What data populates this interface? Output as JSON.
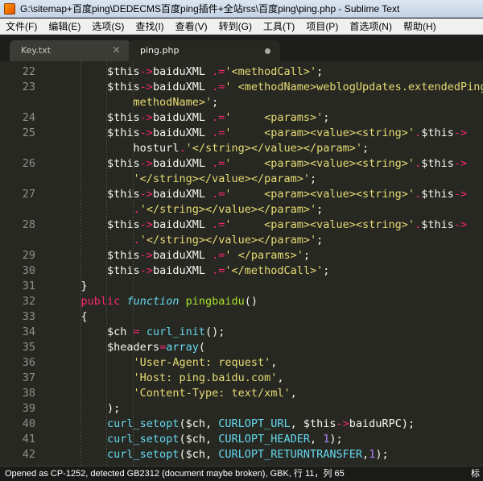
{
  "window": {
    "title": "G:\\sitemap+百度ping\\DEDECMS百度ping插件+全站rss\\百度ping\\ping.php - Sublime Text"
  },
  "menu": [
    {
      "name": "menu-file",
      "label": "文件(F)"
    },
    {
      "name": "menu-edit",
      "label": "编辑(E)"
    },
    {
      "name": "menu-selection",
      "label": "选项(S)"
    },
    {
      "name": "menu-find",
      "label": "查找(I)"
    },
    {
      "name": "menu-view",
      "label": "查看(V)"
    },
    {
      "name": "menu-goto",
      "label": "转到(G)"
    },
    {
      "name": "menu-tools",
      "label": "工具(T)"
    },
    {
      "name": "menu-project",
      "label": "项目(P)"
    },
    {
      "name": "menu-preferences",
      "label": "首选项(N)"
    },
    {
      "name": "menu-help",
      "label": "帮助(H)"
    }
  ],
  "tabs": [
    {
      "label": "Key.txt",
      "active": false
    },
    {
      "label": "ping.php",
      "active": true
    }
  ],
  "editor": {
    "lines": [
      {
        "n": "22",
        "tokens": [
          [
            "        ",
            ""
          ],
          [
            "$this",
            "t-var"
          ],
          [
            "->",
            "t-op"
          ],
          [
            "baiduXML ",
            "t-var"
          ],
          [
            ".=",
            "t-op"
          ],
          [
            "'<methodCall>'",
            "t-str"
          ],
          [
            ";",
            "t-var"
          ]
        ]
      },
      {
        "n": "23",
        "tokens": [
          [
            "        ",
            ""
          ],
          [
            "$this",
            "t-var"
          ],
          [
            "->",
            "t-op"
          ],
          [
            "baiduXML ",
            "t-var"
          ],
          [
            ".=",
            "t-op"
          ],
          [
            "' <methodName>weblogUpdates.extendedPing</",
            "t-str"
          ]
        ]
      },
      {
        "n": "",
        "tokens": [
          [
            "            ",
            ""
          ],
          [
            "methodName>'",
            "t-str"
          ],
          [
            ";",
            "t-var"
          ]
        ]
      },
      {
        "n": "24",
        "tokens": [
          [
            "        ",
            ""
          ],
          [
            "$this",
            "t-var"
          ],
          [
            "->",
            "t-op"
          ],
          [
            "baiduXML ",
            "t-var"
          ],
          [
            ".=",
            "t-op"
          ],
          [
            "'     <params>'",
            "t-str"
          ],
          [
            ";",
            "t-var"
          ]
        ]
      },
      {
        "n": "25",
        "tokens": [
          [
            "        ",
            ""
          ],
          [
            "$this",
            "t-var"
          ],
          [
            "->",
            "t-op"
          ],
          [
            "baiduXML ",
            "t-var"
          ],
          [
            ".=",
            "t-op"
          ],
          [
            "'     <param><value><string>'",
            "t-str"
          ],
          [
            ".",
            "t-op"
          ],
          [
            "$this",
            "t-var"
          ],
          [
            "->",
            "t-op"
          ]
        ]
      },
      {
        "n": "",
        "tokens": [
          [
            "            ",
            ""
          ],
          [
            "hosturl",
            "t-var"
          ],
          [
            ".",
            "t-op"
          ],
          [
            "'</string></value></param>'",
            "t-str"
          ],
          [
            ";",
            "t-var"
          ]
        ]
      },
      {
        "n": "26",
        "tokens": [
          [
            "        ",
            ""
          ],
          [
            "$this",
            "t-var"
          ],
          [
            "->",
            "t-op"
          ],
          [
            "baiduXML ",
            "t-var"
          ],
          [
            ".=",
            "t-op"
          ],
          [
            "'     <param><value><string>'",
            "t-str"
          ],
          [
            ".",
            "t-op"
          ],
          [
            "$this",
            "t-var"
          ],
          [
            "->",
            "t-op"
          ]
        ]
      },
      {
        "n": "",
        "tokens": [
          [
            "            ",
            ""
          ],
          [
            "'</string></value></param>'",
            "t-str"
          ],
          [
            ";",
            "t-var"
          ]
        ]
      },
      {
        "n": "27",
        "tokens": [
          [
            "        ",
            ""
          ],
          [
            "$this",
            "t-var"
          ],
          [
            "->",
            "t-op"
          ],
          [
            "baiduXML ",
            "t-var"
          ],
          [
            ".=",
            "t-op"
          ],
          [
            "'     <param><value><string>'",
            "t-str"
          ],
          [
            ".",
            "t-op"
          ],
          [
            "$this",
            "t-var"
          ],
          [
            "->",
            "t-op"
          ]
        ]
      },
      {
        "n": "",
        "tokens": [
          [
            "            ",
            ""
          ],
          [
            ".",
            "t-op"
          ],
          [
            "'</string></value></param>'",
            "t-str"
          ],
          [
            ";",
            "t-var"
          ]
        ]
      },
      {
        "n": "28",
        "tokens": [
          [
            "        ",
            ""
          ],
          [
            "$this",
            "t-var"
          ],
          [
            "->",
            "t-op"
          ],
          [
            "baiduXML ",
            "t-var"
          ],
          [
            ".=",
            "t-op"
          ],
          [
            "'     <param><value><string>'",
            "t-str"
          ],
          [
            ".",
            "t-op"
          ],
          [
            "$this",
            "t-var"
          ],
          [
            "->",
            "t-op"
          ]
        ]
      },
      {
        "n": "",
        "tokens": [
          [
            "            ",
            ""
          ],
          [
            ".",
            "t-op"
          ],
          [
            "'</string></value></param>'",
            "t-str"
          ],
          [
            ";",
            "t-var"
          ]
        ]
      },
      {
        "n": "29",
        "tokens": [
          [
            "        ",
            ""
          ],
          [
            "$this",
            "t-var"
          ],
          [
            "->",
            "t-op"
          ],
          [
            "baiduXML ",
            "t-var"
          ],
          [
            ".=",
            "t-op"
          ],
          [
            "' </params>'",
            "t-str"
          ],
          [
            ";",
            "t-var"
          ]
        ]
      },
      {
        "n": "30",
        "tokens": [
          [
            "        ",
            ""
          ],
          [
            "$this",
            "t-var"
          ],
          [
            "->",
            "t-op"
          ],
          [
            "baiduXML ",
            "t-var"
          ],
          [
            ".=",
            "t-op"
          ],
          [
            "'</methodCall>'",
            "t-str"
          ],
          [
            ";",
            "t-var"
          ]
        ]
      },
      {
        "n": "31",
        "tokens": [
          [
            "    ",
            ""
          ],
          [
            "}",
            "t-var"
          ]
        ]
      },
      {
        "n": "32",
        "tokens": [
          [
            "    ",
            ""
          ],
          [
            "public",
            "t-kw"
          ],
          [
            " ",
            ""
          ],
          [
            "function",
            "t-storage"
          ],
          [
            " ",
            ""
          ],
          [
            "pingbaidu",
            "t-entity"
          ],
          [
            "()",
            "t-var"
          ]
        ]
      },
      {
        "n": "33",
        "tokens": [
          [
            "    ",
            ""
          ],
          [
            "{",
            "t-var"
          ]
        ]
      },
      {
        "n": "34",
        "tokens": [
          [
            "        ",
            ""
          ],
          [
            "$ch",
            "t-var"
          ],
          [
            " = ",
            "t-op"
          ],
          [
            "curl_init",
            "t-fn"
          ],
          [
            "();",
            "t-var"
          ]
        ]
      },
      {
        "n": "35",
        "tokens": [
          [
            "        ",
            ""
          ],
          [
            "$headers",
            "t-var"
          ],
          [
            "=",
            "t-op"
          ],
          [
            "array",
            "t-fn"
          ],
          [
            "(",
            "t-var"
          ]
        ]
      },
      {
        "n": "36",
        "tokens": [
          [
            "            ",
            ""
          ],
          [
            "'User-Agent: request'",
            "t-str"
          ],
          [
            ",",
            "t-var"
          ]
        ]
      },
      {
        "n": "37",
        "tokens": [
          [
            "            ",
            ""
          ],
          [
            "'Host: ping.baidu.com'",
            "t-str"
          ],
          [
            ",",
            "t-var"
          ]
        ]
      },
      {
        "n": "38",
        "tokens": [
          [
            "            ",
            ""
          ],
          [
            "'Content-Type: text/xml'",
            "t-str"
          ],
          [
            ",",
            "t-var"
          ]
        ]
      },
      {
        "n": "39",
        "tokens": [
          [
            "        ",
            ""
          ],
          [
            ");",
            "t-var"
          ]
        ]
      },
      {
        "n": "40",
        "tokens": [
          [
            "        ",
            ""
          ],
          [
            "curl_setopt",
            "t-fn"
          ],
          [
            "($ch, ",
            "t-var"
          ],
          [
            "CURLOPT_URL",
            "t-const"
          ],
          [
            ", ",
            "t-var"
          ],
          [
            "$this",
            "t-var"
          ],
          [
            "->",
            "t-op"
          ],
          [
            "baiduRPC);",
            "t-var"
          ]
        ]
      },
      {
        "n": "41",
        "tokens": [
          [
            "        ",
            ""
          ],
          [
            "curl_setopt",
            "t-fn"
          ],
          [
            "($ch, ",
            "t-var"
          ],
          [
            "CURLOPT_HEADER",
            "t-const"
          ],
          [
            ", ",
            "t-var"
          ],
          [
            "1",
            "t-num"
          ],
          [
            ");",
            "t-var"
          ]
        ]
      },
      {
        "n": "42",
        "tokens": [
          [
            "        ",
            ""
          ],
          [
            "curl_setopt",
            "t-fn"
          ],
          [
            "($ch, ",
            "t-var"
          ],
          [
            "CURLOPT_RETURNTRANSFER",
            "t-const"
          ],
          [
            ",",
            "t-var"
          ],
          [
            "1",
            "t-num"
          ],
          [
            ");",
            "t-var"
          ]
        ]
      }
    ]
  },
  "status": {
    "text": "Opened as CP-1252, detected GB2312 (document maybe broken), GBK, 行 11，列 65",
    "right": "标"
  }
}
